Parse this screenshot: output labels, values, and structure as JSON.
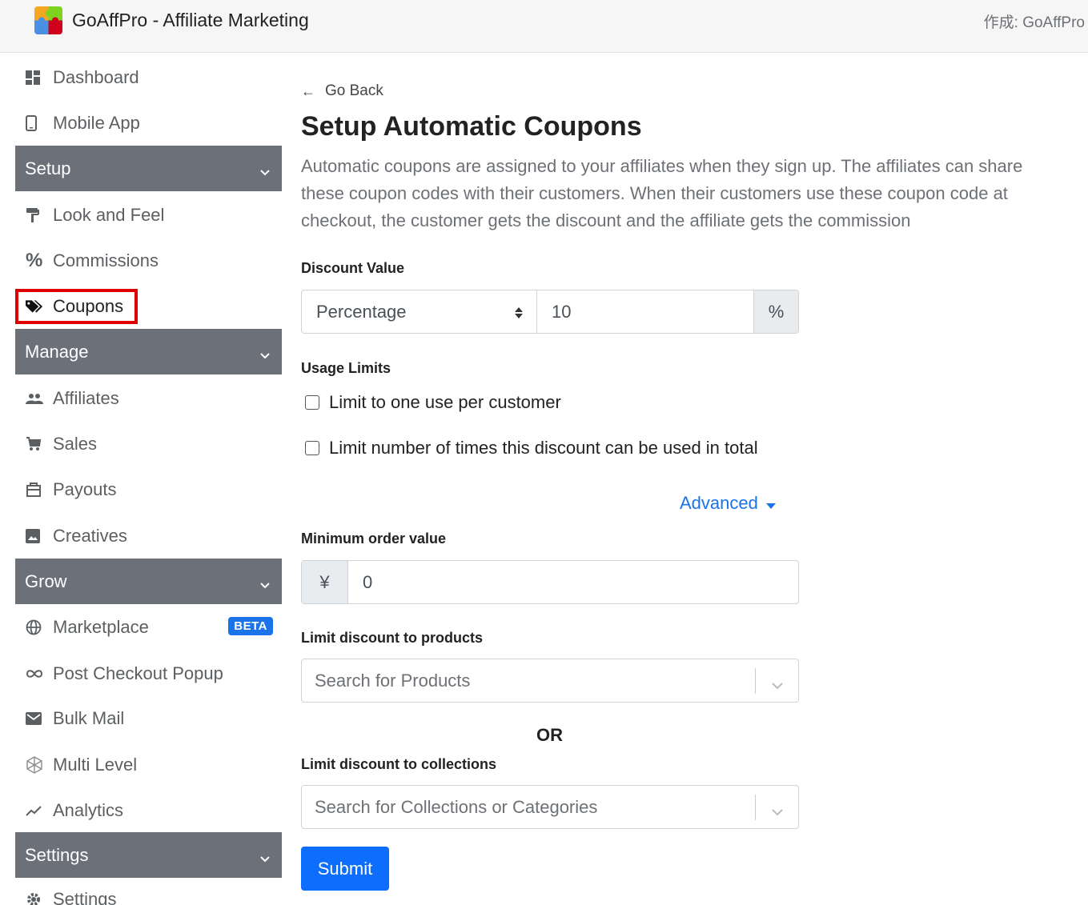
{
  "header": {
    "app_title": "GoAffPro - Affiliate Marketing",
    "byline": "作成: GoAffPro"
  },
  "sidebar": {
    "items": [
      {
        "label": "Dashboard",
        "icon": "dashboard-icon"
      },
      {
        "label": "Mobile App",
        "icon": "mobile-icon"
      },
      {
        "label": "Look and Feel",
        "icon": "paint-roller-icon"
      },
      {
        "label": "Commissions",
        "icon": "percent-icon"
      },
      {
        "label": "Coupons",
        "icon": "tags-icon"
      },
      {
        "label": "Affiliates",
        "icon": "people-icon"
      },
      {
        "label": "Sales",
        "icon": "cart-icon"
      },
      {
        "label": "Payouts",
        "icon": "payout-icon"
      },
      {
        "label": "Creatives",
        "icon": "image-icon"
      },
      {
        "label": "Marketplace",
        "icon": "globe-icon",
        "badge": "BETA"
      },
      {
        "label": "Post Checkout Popup",
        "icon": "infinity-icon"
      },
      {
        "label": "Bulk Mail",
        "icon": "mail-icon"
      },
      {
        "label": "Multi Level",
        "icon": "network-icon"
      },
      {
        "label": "Analytics",
        "icon": "trend-icon"
      },
      {
        "label": "Settings",
        "icon": "gear-icon"
      }
    ],
    "sections": [
      "Setup",
      "Manage",
      "Grow",
      "Settings"
    ]
  },
  "main": {
    "go_back": "Go Back",
    "title": "Setup Automatic Coupons",
    "description": "Automatic coupons are assigned to your affiliates when they sign up. The affiliates can share these coupon codes with their customers. When their customers use these coupon code at checkout, the customer gets the discount and the affiliate gets the commission",
    "discount_value_label": "Discount Value",
    "discount_type": "Percentage",
    "discount_amount": "10",
    "discount_suffix": "%",
    "usage_limits_label": "Usage Limits",
    "limit_one_per_customer": "Limit to one use per customer",
    "limit_total": "Limit number of times this discount can be used in total",
    "advanced": "Advanced",
    "min_order_label": "Minimum order value",
    "currency_symbol": "¥",
    "min_order_value": "0",
    "limit_products_label": "Limit discount to products",
    "products_placeholder": "Search for Products",
    "or_text": "OR",
    "limit_collections_label": "Limit discount to collections",
    "collections_placeholder": "Search for Collections or Categories",
    "submit": "Submit"
  },
  "colors": {
    "accent": "#0d6efd",
    "link": "#1a73e8",
    "section_bg": "#6b7079",
    "highlight": "#e00000"
  }
}
